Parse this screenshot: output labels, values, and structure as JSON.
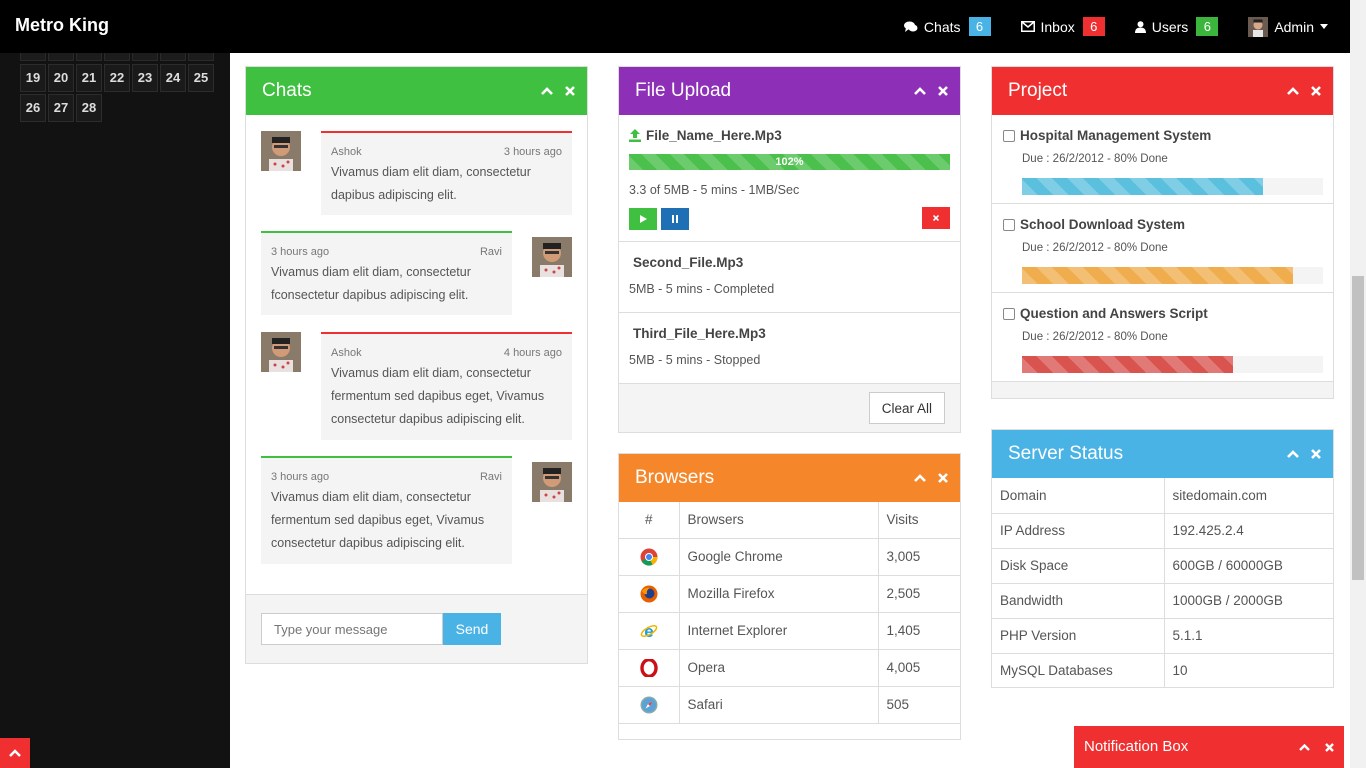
{
  "app": {
    "title": "Metro King"
  },
  "topnav": {
    "chats": {
      "label": "Chats",
      "count": "6",
      "color": "#4ab3e6"
    },
    "inbox": {
      "label": "Inbox",
      "count": "6",
      "color": "#f03030"
    },
    "users": {
      "label": "Users",
      "count": "6",
      "color": "#3cb53c"
    },
    "admin": {
      "label": "Admin"
    }
  },
  "calendar": {
    "rows": [
      [
        "19",
        "20",
        "21",
        "22",
        "23",
        "24",
        "25"
      ],
      [
        "26",
        "27",
        "28"
      ]
    ]
  },
  "chats": {
    "title": "Chats",
    "color": "#40c040",
    "messages": [
      {
        "name": "Ashok",
        "time": "3 hours ago",
        "text": "Vivamus diam elit diam, consectetur dapibus adipiscing elit."
      },
      {
        "name": "Ravi",
        "time": "3 hours ago",
        "text": "Vivamus diam elit diam, consectetur fconsectetur dapibus adipiscing elit."
      },
      {
        "name": "Ashok",
        "time": "4 hours ago",
        "text": "Vivamus diam elit diam, consectetur fermentum sed dapibus eget, Vivamus consectetur dapibus adipiscing elit."
      },
      {
        "name": "Ravi",
        "time": "3 hours ago",
        "text": "Vivamus diam elit diam, consectetur fermentum sed dapibus eget, Vivamus consectetur dapibus adipiscing elit."
      }
    ],
    "input_placeholder": "Type your message",
    "send_label": "Send"
  },
  "file_upload": {
    "title": "File Upload",
    "color": "#8e2fb8",
    "current": {
      "name": "File_Name_Here.Mp3",
      "progress_label": "102%",
      "progress": 1.0,
      "info": "3.3 of 5MB - 5 mins - 1MB/Sec"
    },
    "files": [
      {
        "name": "Second_File.Mp3",
        "info": "5MB - 5 mins - Completed"
      },
      {
        "name": "Third_File_Here.Mp3",
        "info": "5MB - 5 mins - Stopped"
      }
    ],
    "clear_label": "Clear All"
  },
  "browsers": {
    "title": "Browsers",
    "color": "#f5872a",
    "headers": [
      "#",
      "Browsers",
      "Visits"
    ],
    "rows": [
      {
        "icon": "chrome-icon",
        "name": "Google Chrome",
        "visits": "3,005"
      },
      {
        "icon": "firefox-icon",
        "name": "Mozilla Firefox",
        "visits": "2,505"
      },
      {
        "icon": "ie-icon",
        "name": "Internet Explorer",
        "visits": "1,405"
      },
      {
        "icon": "opera-icon",
        "name": "Opera",
        "visits": "4,005"
      },
      {
        "icon": "safari-icon",
        "name": "Safari",
        "visits": "505"
      }
    ]
  },
  "project": {
    "title": "Project",
    "color": "#f03030",
    "items": [
      {
        "name": "Hospital Management System",
        "due": "Due : 26/2/2012 - 80% Done",
        "progress": 0.8,
        "color": "#5bc0de"
      },
      {
        "name": "School Download System",
        "due": "Due : 26/2/2012 - 80% Done",
        "progress": 0.9,
        "color": "#f0ad4e"
      },
      {
        "name": "Question and Answers Script",
        "due": "Due : 26/2/2012 - 80% Done",
        "progress": 0.7,
        "color": "#d9534f"
      }
    ]
  },
  "server_status": {
    "title": "Server Status",
    "color": "#4ab3e6",
    "rows": [
      {
        "label": "Domain",
        "value": "sitedomain.com"
      },
      {
        "label": "IP Address",
        "value": "192.425.2.4"
      },
      {
        "label": "Disk Space",
        "value": "600GB / 60000GB"
      },
      {
        "label": "Bandwidth",
        "value": "1000GB / 2000GB"
      },
      {
        "label": "PHP Version",
        "value": "5.1.1"
      },
      {
        "label": "MySQL Databases",
        "value": "10"
      }
    ]
  },
  "notification_box": {
    "title": "Notification Box"
  }
}
